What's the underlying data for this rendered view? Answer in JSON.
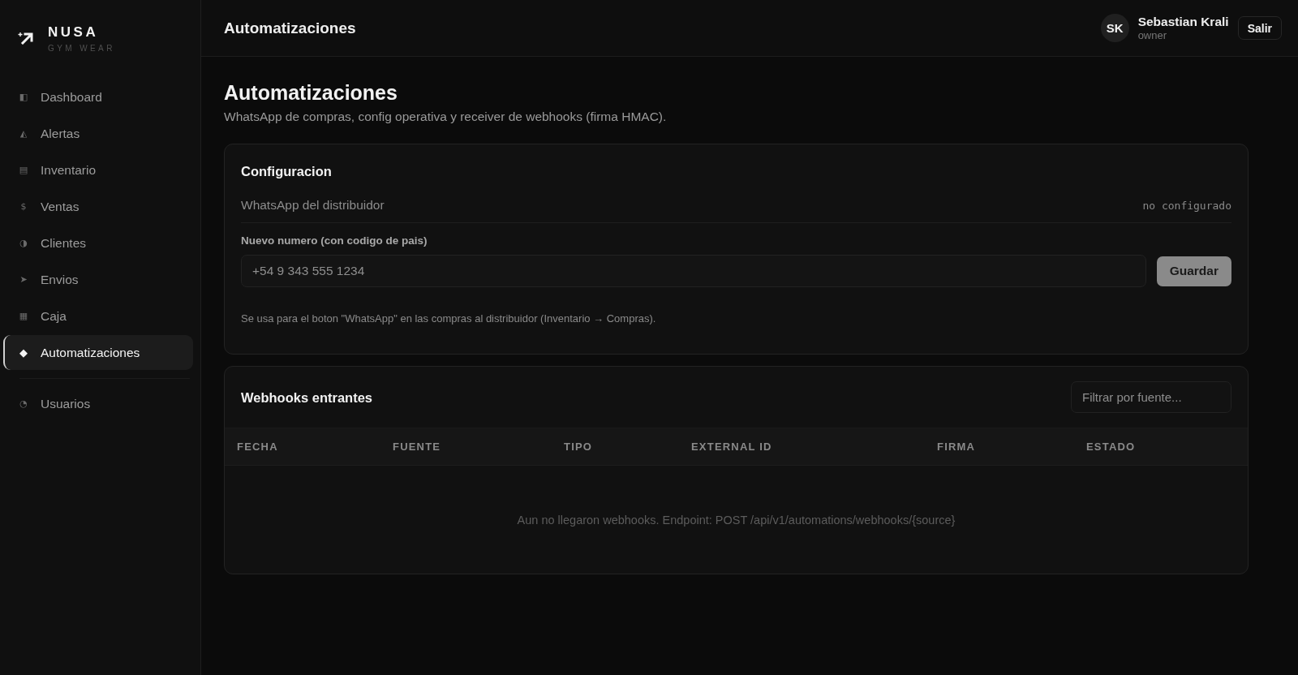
{
  "brand": {
    "name": "NUSA",
    "tagline": "GYM WEAR"
  },
  "sidebar": {
    "groups": [
      {
        "items": [
          {
            "icon": "◧",
            "label": "Dashboard",
            "selected": false
          },
          {
            "icon": "◭",
            "label": "Alertas",
            "selected": false
          },
          {
            "icon": "▤",
            "label": "Inventario",
            "selected": false
          },
          {
            "icon": "$",
            "label": "Ventas",
            "selected": false
          },
          {
            "icon": "◑",
            "label": "Clientes",
            "selected": false
          },
          {
            "icon": "➤",
            "label": "Envios",
            "selected": false
          },
          {
            "icon": "▦",
            "label": "Caja",
            "selected": false
          },
          {
            "icon": "◆",
            "label": "Automatizaciones",
            "selected": true
          }
        ]
      },
      {
        "items": [
          {
            "icon": "◔",
            "label": "Usuarios",
            "selected": false
          }
        ]
      }
    ]
  },
  "header": {
    "title": "Automatizaciones",
    "user": {
      "initials": "SK",
      "name": "Sebastian Krali",
      "role": "owner"
    },
    "logout_button": "Salir"
  },
  "page": {
    "title": "Automatizaciones",
    "subtitle": "WhatsApp de compras, config operativa y receiver de webhooks (firma HMAC)."
  },
  "config": {
    "title": "Configuracion",
    "rows": [
      {
        "label": "WhatsApp del distribuidor",
        "value": "no configurado"
      }
    ],
    "field": {
      "label": "Nuevo numero (con codigo de pais)",
      "placeholder": "+54 9 343 555 1234"
    },
    "save_button": {
      "label": "Guardar",
      "disabled": true
    },
    "hint": "Se usa para el boton \"WhatsApp\" en las compras al distribuidor (Inventario → Compras)."
  },
  "webhooks": {
    "title": "Webhooks entrantes",
    "filter": {
      "placeholder": "Filtrar por fuente..."
    },
    "table": {
      "columns": [
        "FECHA",
        "FUENTE",
        "TIPO",
        "EXTERNAL ID",
        "FIRMA",
        "ESTADO"
      ],
      "empty_message": "Aun no llegaron webhooks. Endpoint: POST /api/v1/automations/webhooks/{source}"
    }
  }
}
